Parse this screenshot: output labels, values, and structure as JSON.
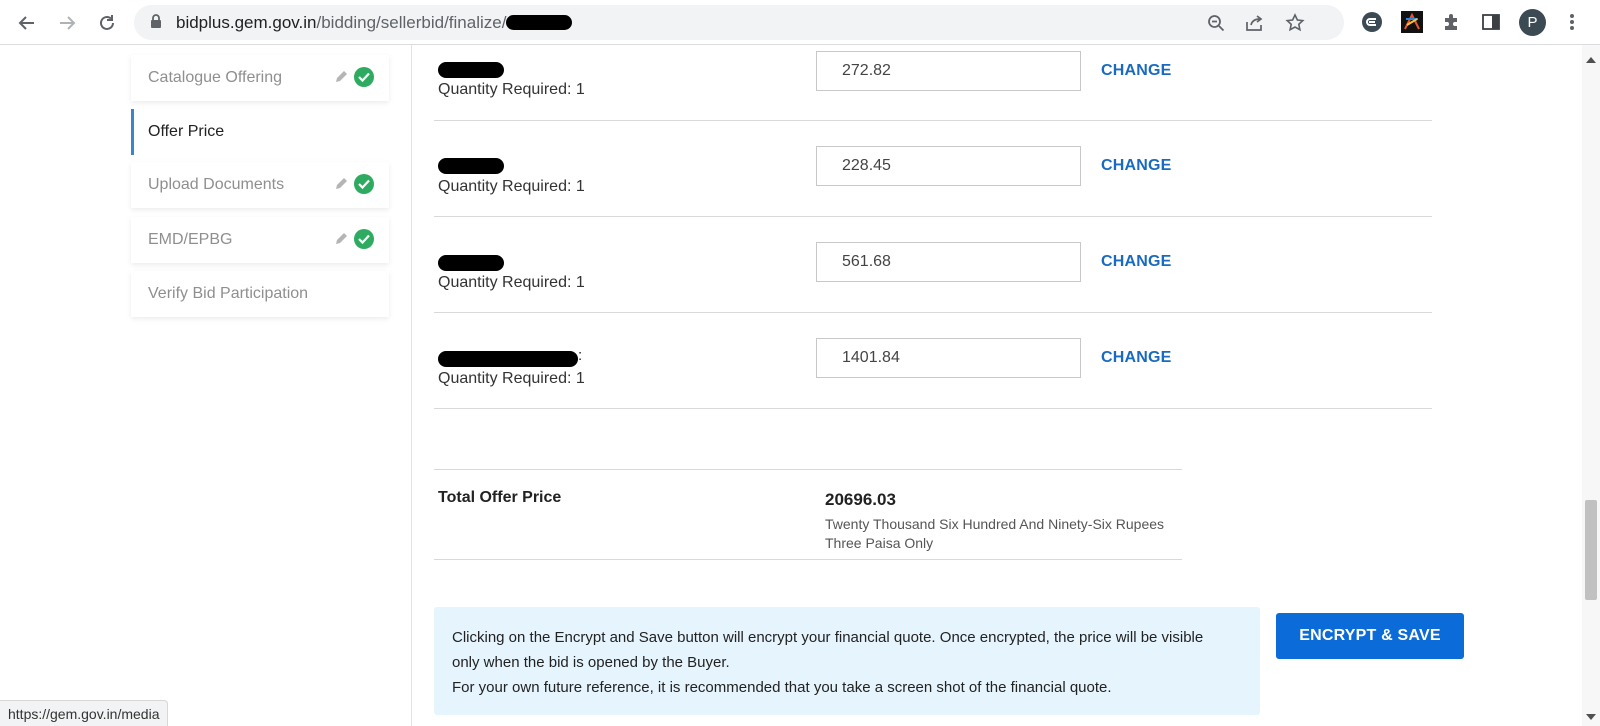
{
  "browser": {
    "url_domain": "bidplus.gem.gov.in",
    "url_path": "/bidding/sellerbid/finalize/",
    "avatar_letter": "P",
    "status_url": "https://gem.gov.in/media"
  },
  "sidebar": {
    "items": [
      {
        "label": "Catalogue Offering",
        "completed": true
      },
      {
        "label": "Offer Price",
        "active": true
      },
      {
        "label": "Upload Documents",
        "completed": true
      },
      {
        "label": "EMD/EPBG",
        "completed": true
      },
      {
        "label": "Verify Bid Participation"
      }
    ]
  },
  "offer_rows": [
    {
      "quantity_label": "Quantity Required: 1",
      "price": "272.82",
      "change_label": "CHANGE"
    },
    {
      "quantity_label": "Quantity Required: 1",
      "price": "228.45",
      "change_label": "CHANGE"
    },
    {
      "quantity_label": "Quantity Required: 1",
      "price": "561.68",
      "change_label": "CHANGE"
    },
    {
      "quantity_label": "Quantity Required: 1",
      "price": "1401.84",
      "change_label": "CHANGE"
    }
  ],
  "total": {
    "label": "Total Offer Price",
    "value": "20696.03",
    "words_line1": "Twenty Thousand Six Hundred And Ninety-Six Rupees",
    "words_line2": "Three Paisa Only"
  },
  "notice": {
    "line1": "Clicking on the Encrypt and Save button will encrypt your financial quote. Once encrypted, the price will be visible",
    "line2": "only when the bid is opened by the Buyer.",
    "line3": "For your own future reference, it is recommended that you take a screen shot of the financial quote."
  },
  "encrypt_button_label": "ENCRYPT & SAVE",
  "colors": {
    "accent_blue": "#0b6bd8",
    "link_blue": "#1a6bbf",
    "check_green": "#2eab60",
    "notice_bg": "#e6f4fd"
  }
}
